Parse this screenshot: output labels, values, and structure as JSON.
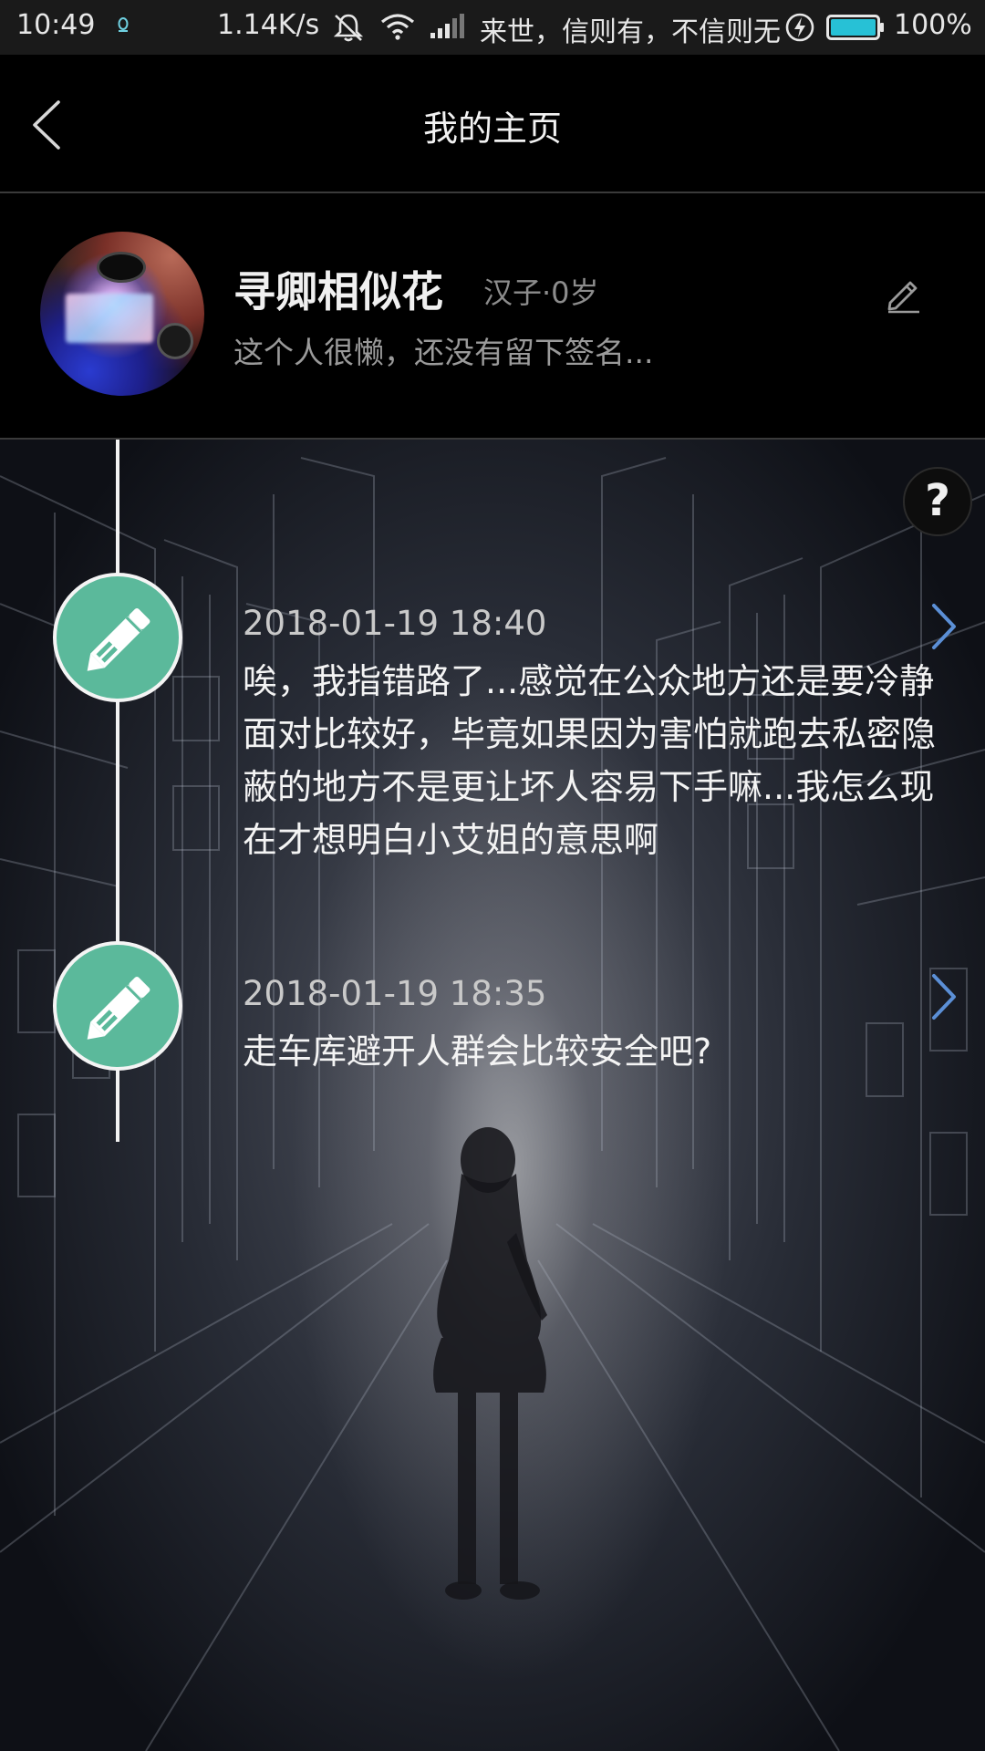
{
  "status_bar": {
    "time": "10:49",
    "net_speed": "1.14K/s",
    "carrier": "来世，信则有，不信则无",
    "battery": "100%",
    "icons": [
      "qq-icon",
      "mute-icon",
      "wifi-icon",
      "signal-icon",
      "charging-icon",
      "battery-icon"
    ]
  },
  "header": {
    "title": "我的主页",
    "back_icon": "chevron-left-icon"
  },
  "profile": {
    "name": "寻卿相似花",
    "meta": "汉子·0岁",
    "signature": "这个人很懒，还没有留下签名...",
    "edit_icon": "pencil-icon"
  },
  "help": {
    "label": "?"
  },
  "entries": [
    {
      "time": "2018-01-19 18:40",
      "text": "唉，我指错路了...感觉在公众地方还是要冷静面对比较好，毕竟如果因为害怕就跑去私密隐蔽的地方不是更让坏人容易下手嘛...我怎么现在才想明白小艾姐的意思啊",
      "icon": "pencil-icon"
    },
    {
      "time": "2018-01-19 18:35",
      "text": "走车库避开人群会比较安全吧?",
      "icon": "pencil-icon"
    }
  ],
  "colors": {
    "accent": "#5bb99b",
    "arrow": "#5b8fd6",
    "status_bar": "#1a1a1a",
    "background": "#000000"
  }
}
